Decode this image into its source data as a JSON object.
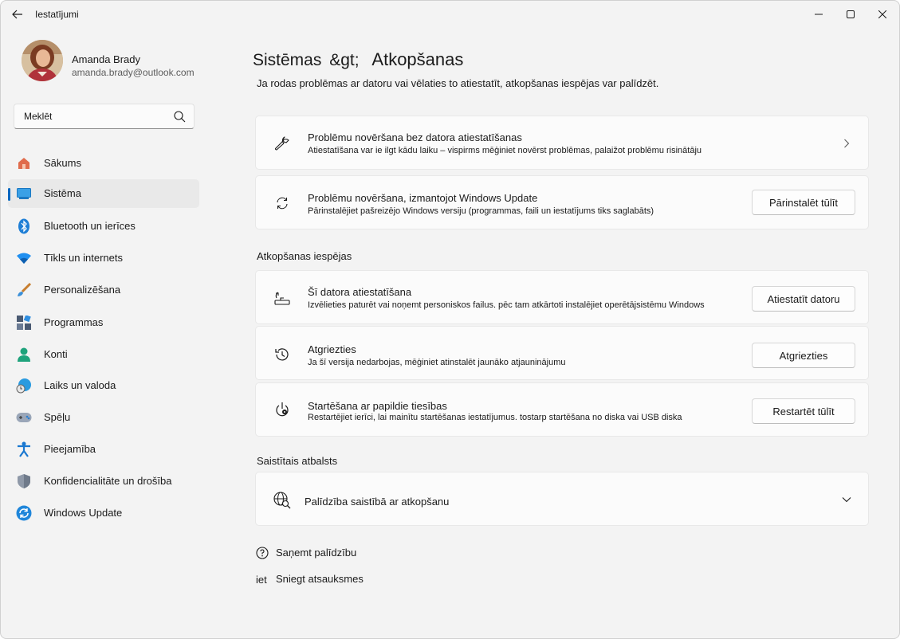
{
  "window": {
    "title": "Iestatījumi"
  },
  "profile": {
    "name": "Amanda Brady",
    "email": "amanda.brady@outlook.com"
  },
  "search": {
    "placeholder": "Meklēt"
  },
  "sidebar": {
    "items": [
      {
        "label": "Sākums",
        "icon": "home-icon"
      },
      {
        "label": "Sistēma",
        "icon": "system-icon",
        "active": true
      },
      {
        "label": "Bluetooth un ierīces",
        "icon": "bluetooth-icon"
      },
      {
        "label": "Tīkls un internets",
        "icon": "wifi-icon"
      },
      {
        "label": "Personalizēšana",
        "icon": "brush-icon"
      },
      {
        "label": "Programmas",
        "icon": "apps-icon"
      },
      {
        "label": "Konti",
        "icon": "account-icon"
      },
      {
        "label": "Laiks un valoda",
        "icon": "globe-clock-icon"
      },
      {
        "label": "Spēļu",
        "icon": "gamepad-icon"
      },
      {
        "label": "Pieejamība",
        "icon": "accessibility-icon"
      },
      {
        "label": "Konfidencialitāte un drošība",
        "icon": "shield-icon"
      },
      {
        "label": "Windows Update",
        "icon": "windows-update-icon"
      }
    ]
  },
  "breadcrumb": {
    "parent": "Sistēmas",
    "separator": "&gt;",
    "current": "Atkopšanas"
  },
  "page": {
    "description": "Ja rodas problēmas ar datoru vai vēlaties to atiestatīt, atkopšanas iespējas var palīdzēt."
  },
  "top_cards": [
    {
      "title": "Problēmu novēršana bez datora atiestatīšanas",
      "subtitle": "Atiestatīšana var ie ilgt kādu laiku – vispirms mēģiniet novērst problēmas, palaižot problēmu risinātāju",
      "icon": "wrench-icon"
    },
    {
      "title": "Problēmu novēršana, izmantojot Windows Update",
      "subtitle": "Pārinstalējiet pašreizējo Windows versiju (programmas, faili un iestatījums tiks saglabāts)",
      "button": "Pārinstalēt tūlīt",
      "icon": "sync-icon"
    }
  ],
  "recovery_section": {
    "heading": "Atkopšanas iespējas",
    "cards": [
      {
        "title": "Šī datora atiestatīšana",
        "subtitle": "Izvēlieties paturēt vai noņemt personiskos failus. pēc tam atkārtoti instalējiet operētājsistēmu Windows",
        "button": "Atiestatīt datoru",
        "icon": "reset-pc-icon"
      },
      {
        "title": "Atgriezties",
        "subtitle": "Ja šī versija nedarbojas, mēģiniet atinstalēt jaunāko atjauninājumu",
        "button": "Atgriezties",
        "icon": "history-icon"
      },
      {
        "title": "Startēšana ar papildie tiesības",
        "subtitle": "Restartējiet ierīci, lai mainītu startēšanas iestatījumus. tostarp startēšana no diska vai USB diska",
        "button": "Restartēt tūlīt",
        "icon": "power-settings-icon"
      }
    ]
  },
  "support_section": {
    "heading": "Saistītais atbalsts",
    "item": {
      "title": "Palīdzība saistībā ar atkopšanu",
      "icon": "globe-search-icon"
    }
  },
  "footer": {
    "help": {
      "label": "Saņemt palīdzību",
      "icon": "help-icon"
    },
    "feedback": {
      "label": "Sniegt atsauksmes",
      "prefix": "iet"
    }
  },
  "colors": {
    "accent": "#0067c0",
    "window_bg": "#f3f3f3",
    "card_bg": "#fbfbfb"
  }
}
